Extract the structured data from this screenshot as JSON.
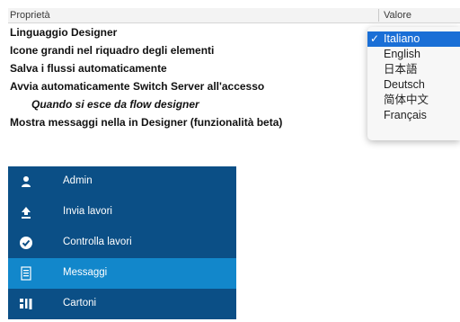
{
  "preferences": {
    "header": {
      "name": "Proprietà",
      "value": "Valore"
    },
    "rows": [
      {
        "label": "Linguaggio Designer",
        "indent": false
      },
      {
        "label": "Icone grandi nel riquadro degli elementi",
        "indent": false
      },
      {
        "label": "Salva i flussi automaticamente",
        "indent": false
      },
      {
        "label": "Avvia automaticamente Switch Server all'accesso",
        "indent": false
      },
      {
        "label": "Quando si esce da flow designer",
        "indent": true
      },
      {
        "label": "Mostra messaggi nella in Designer (funzionalità beta)",
        "indent": false
      }
    ]
  },
  "language_dropdown": {
    "selected": "Italiano",
    "options": [
      "Italiano",
      "English",
      "日本語",
      "Deutsch",
      "简体中文",
      "Français"
    ],
    "check_mark": "✓",
    "selected_color": "#1a6fd6"
  },
  "nav": {
    "background": "#0b4f86",
    "active_color": "#1287cb",
    "items": [
      {
        "label": "Admin",
        "icon": "user-icon",
        "active": false
      },
      {
        "label": "Invia lavori",
        "icon": "upload-icon",
        "active": false
      },
      {
        "label": "Controlla lavori",
        "icon": "check-circle-icon",
        "active": false
      },
      {
        "label": "Messaggi",
        "icon": "document-lines-icon",
        "active": true
      },
      {
        "label": "Cartoni",
        "icon": "grid-folders-icon",
        "active": false
      }
    ]
  }
}
